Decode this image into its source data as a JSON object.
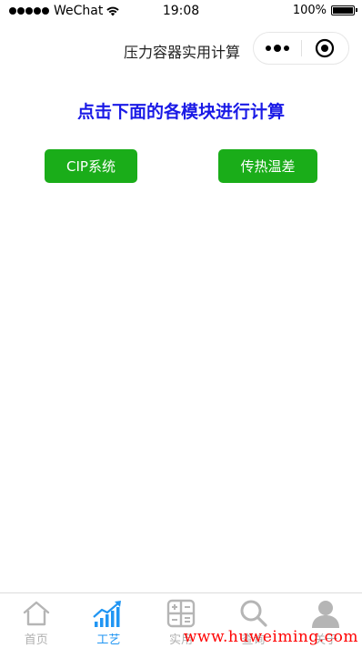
{
  "status_bar": {
    "carrier": "WeChat",
    "time": "19:08",
    "battery": "100%"
  },
  "nav": {
    "title": "压力容器实用计算"
  },
  "main": {
    "headline": "点击下面的各模块进行计算",
    "buttons": [
      {
        "label": "CIP系统"
      },
      {
        "label": "传热温差"
      }
    ]
  },
  "tab_bar": {
    "tabs": [
      {
        "label": "首页",
        "icon": "home-icon"
      },
      {
        "label": "工艺",
        "icon": "growth-chart-icon",
        "active": true
      },
      {
        "label": "实用",
        "icon": "calculator-icon"
      },
      {
        "label": "查询",
        "icon": "search-icon"
      },
      {
        "label": "关于",
        "icon": "person-icon"
      }
    ]
  },
  "watermark": "www.huweiming.com",
  "colors": {
    "button_green": "#1aad19",
    "headline_blue": "#1a1ae6",
    "tab_active": "#2196f3",
    "tab_inactive": "#b0b0b0",
    "watermark_red": "#ff0000"
  }
}
